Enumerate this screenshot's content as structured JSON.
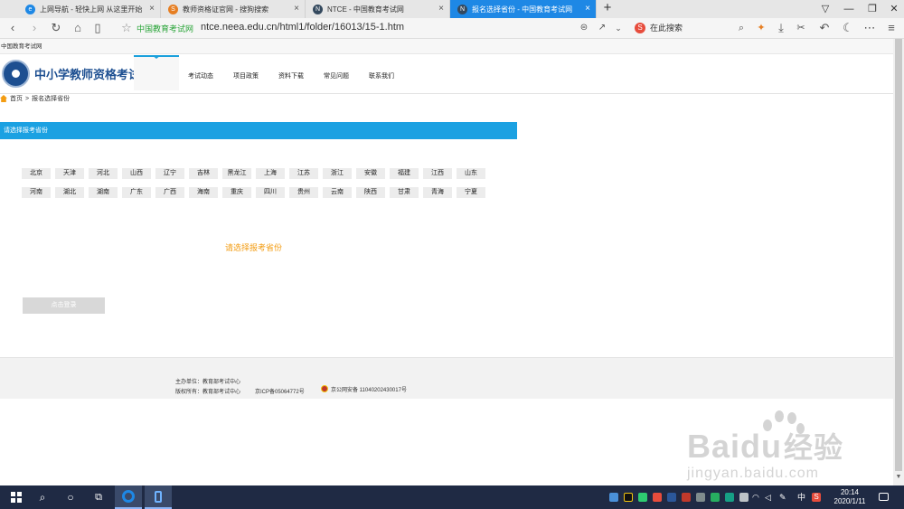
{
  "browser": {
    "tabs": [
      {
        "label": "上网导航 - 轻快上网 从这里开始",
        "icon": "browser-e-icon",
        "color": "#1e88e5"
      },
      {
        "label": "教师资格证官网 - 搜狗搜索",
        "icon": "sogou-icon",
        "color": "#e67e22"
      },
      {
        "label": "NTCE - 中国教育考试网",
        "icon": "ntce-icon",
        "color": "#34495e"
      },
      {
        "label": "报名选择省份 - 中国教育考试网",
        "icon": "ntce-icon",
        "color": "#34495e"
      }
    ],
    "new_tab": "+",
    "window_controls": [
      "▽",
      "—",
      "❐",
      "✕"
    ],
    "site_name": "中国教育考试网",
    "url": "ntce.neea.edu.cn/html1/folder/16013/15-1.htm",
    "search_placeholder": "在此搜索"
  },
  "page": {
    "top_strip": "中国教育考试网",
    "logo_text": "中小学教师资格考试",
    "nav": [
      "考试动态",
      "项目政策",
      "资料下载",
      "常见问题",
      "联系我们"
    ],
    "breadcrumb": [
      "首页",
      ">",
      "报名选择省份"
    ],
    "province_header": "请选择报考省份",
    "provinces_row1": [
      "北京",
      "天津",
      "河北",
      "山西",
      "辽宁",
      "吉林",
      "黑龙江",
      "上海",
      "江苏",
      "浙江",
      "安徽",
      "福建",
      "江西",
      "山东"
    ],
    "provinces_row2": [
      "河南",
      "湖北",
      "湖南",
      "广东",
      "广西",
      "海南",
      "重庆",
      "四川",
      "贵州",
      "云南",
      "陕西",
      "甘肃",
      "青海",
      "宁夏"
    ],
    "prompt": "请选择报考省份",
    "login_button": "点击登录",
    "footer": {
      "host": "主办单位：教育部考试中心",
      "copyright": "版权所有：教育部考试中心",
      "icp": "京ICP备05064772号",
      "police": "京公网安备 11040202430017号"
    }
  },
  "watermark": {
    "brand": "Bai",
    "brand2": "du",
    "cn": "经验",
    "sub": "jingyan.baidu.com"
  },
  "taskbar": {
    "time": "20:14",
    "date": "2020/1/11",
    "ime": "中",
    "ime2": "S"
  },
  "colors": {
    "accent": "#1ba1e2",
    "brand": "#1d4f91",
    "prompt": "#f39c12",
    "taskbar": "#1f2a44"
  }
}
